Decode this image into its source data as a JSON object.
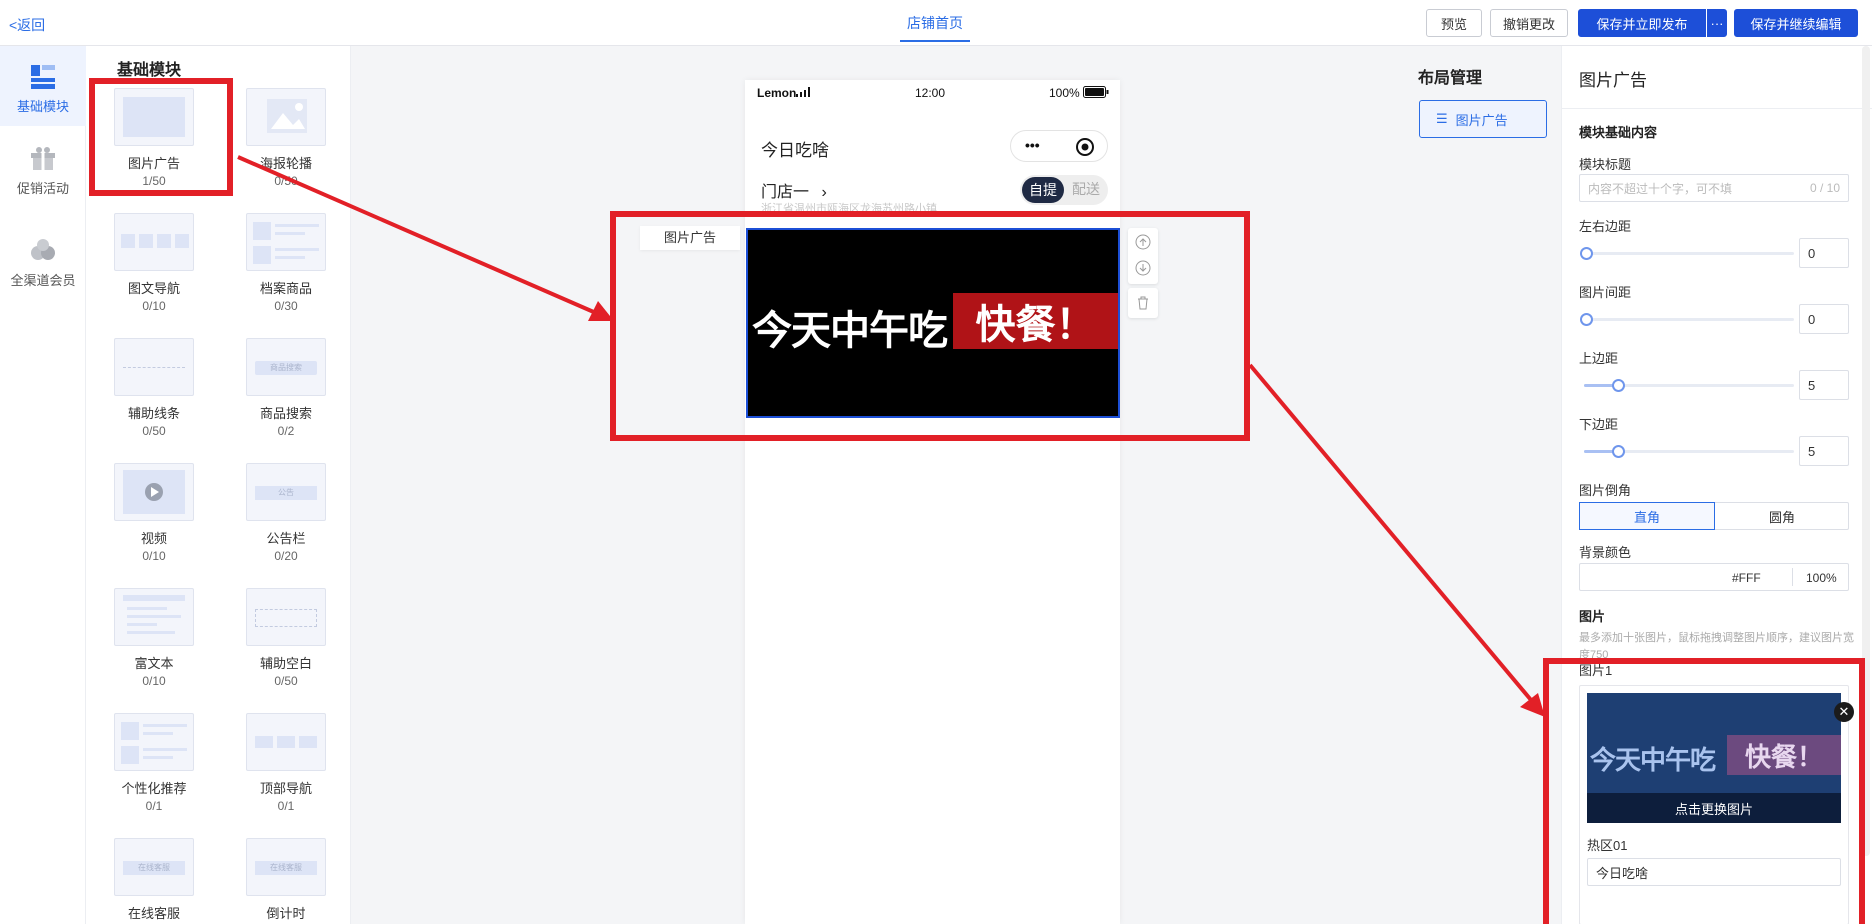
{
  "topbar": {
    "back": "<返回",
    "tab": "店铺首页",
    "preview": "预览",
    "revert": "撤销更改",
    "save_publish": "保存并立即发布",
    "more": "···",
    "save_continue": "保存并继续编辑"
  },
  "rail": [
    {
      "label": "基础模块",
      "icon": "layout-blocks-icon",
      "active": true
    },
    {
      "label": "促销活动",
      "icon": "gift-icon",
      "active": false
    },
    {
      "label": "全渠道会员",
      "icon": "members-icon",
      "active": false
    }
  ],
  "modules": {
    "title": "基础模块",
    "items": [
      {
        "name": "图片广告",
        "count": "1/50",
        "icon": "image-ad-icon"
      },
      {
        "name": "海报轮播",
        "count": "0/50",
        "icon": "poster-carousel-icon"
      },
      {
        "name": "图文导航",
        "count": "0/10",
        "icon": "image-nav-icon"
      },
      {
        "name": "档案商品",
        "count": "0/30",
        "icon": "product-list-icon"
      },
      {
        "name": "辅助线条",
        "count": "0/50",
        "icon": "divider-line-icon"
      },
      {
        "name": "商品搜索",
        "count": "0/2",
        "icon": "search-icon"
      },
      {
        "name": "视频",
        "count": "0/10",
        "icon": "video-icon"
      },
      {
        "name": "公告栏",
        "count": "0/20",
        "icon": "notice-icon"
      },
      {
        "name": "富文本",
        "count": "0/10",
        "icon": "rich-text-icon"
      },
      {
        "name": "辅助空白",
        "count": "0/50",
        "icon": "blank-space-icon"
      },
      {
        "name": "个性化推荐",
        "count": "0/1",
        "icon": "recommend-icon"
      },
      {
        "name": "顶部导航",
        "count": "0/1",
        "icon": "top-nav-icon"
      },
      {
        "name": "在线客服",
        "count": "",
        "icon": "customer-service-icon"
      },
      {
        "name": "倒计时",
        "count": "",
        "icon": "countdown-icon"
      }
    ],
    "search_thumb_text": "商品搜索",
    "notice_thumb_text": "公告",
    "service_thumb_text": "在线客服"
  },
  "phone": {
    "carrier": "Lemon",
    "time": "12:00",
    "battery": "100%",
    "store": "今日吃啥",
    "sub_store": "门店一",
    "address": "浙江省温州市瓯海区龙海苏州路小镇",
    "pickup": "自提",
    "delivery": "配送",
    "ad_label": "图片广告",
    "banner_white": "今天中午吃",
    "banner_red": "快餐！"
  },
  "layout": {
    "title": "布局管理",
    "item": "图片广告"
  },
  "props": {
    "title": "图片广告",
    "basic_section": "模块基础内容",
    "module_title_label": "模块标题",
    "module_title_placeholder": "内容不超过十个字，可不填",
    "module_title_count": "0 / 10",
    "margin_lr_label": "左右边距",
    "margin_lr_value": "0",
    "image_gap_label": "图片间距",
    "image_gap_value": "0",
    "margin_top_label": "上边距",
    "margin_top_value": "5",
    "margin_bottom_label": "下边距",
    "margin_bottom_value": "5",
    "corner_label": "图片倒角",
    "corner_square": "直角",
    "corner_round": "圆角",
    "bg_label": "背景颜色",
    "bg_hex": "#FFF",
    "bg_opacity": "100%",
    "image_section": "图片",
    "image_hint": "最多添加十张图片，鼠标拖拽调整图片顺序，建议图片宽度750",
    "image1_label": "图片1",
    "replace_image": "点击更换图片",
    "hotspot_label": "热区01",
    "hotspot_value": "今日吃啥",
    "close_mark": "✕"
  },
  "colors": {
    "accent": "#2b6de5",
    "primary_button": "#1d4fd8",
    "annotation_red": "#e22027",
    "banner_red": "#b01317"
  }
}
